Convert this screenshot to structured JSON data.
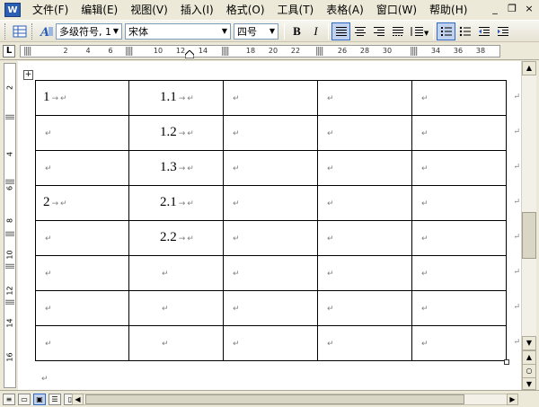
{
  "app": {
    "icon_label": "W"
  },
  "menu": {
    "items": [
      "文件(F)",
      "编辑(E)",
      "视图(V)",
      "插入(I)",
      "格式(O)",
      "工具(T)",
      "表格(A)",
      "窗口(W)",
      "帮助(H)"
    ]
  },
  "window_controls": {
    "minimize": "_",
    "restore": "❐",
    "close": "×"
  },
  "toolbar": {
    "style_value": "多级符号, 1",
    "font_value": "宋体",
    "size_value": "四号",
    "bold": "B",
    "italic": "I"
  },
  "ruler": {
    "tab_selector": "L",
    "numbers": [
      "2",
      "4",
      "6",
      "10",
      "12",
      "14",
      "18",
      "20",
      "22",
      "26",
      "28",
      "30",
      "34",
      "36",
      "38"
    ],
    "vertical_numbers": [
      "2",
      "4",
      "6",
      "8",
      "10",
      "12",
      "14",
      "16"
    ]
  },
  "table": {
    "rows": [
      [
        "1",
        "1.1",
        "",
        "",
        ""
      ],
      [
        "",
        "1.2",
        "",
        "",
        ""
      ],
      [
        "",
        "1.3",
        "",
        "",
        ""
      ],
      [
        "2",
        "2.1",
        "",
        "",
        ""
      ],
      [
        "",
        "2.2",
        "",
        "",
        ""
      ],
      [
        "",
        "",
        "",
        "",
        ""
      ],
      [
        "",
        "",
        "",
        "",
        ""
      ],
      [
        "",
        "",
        "",
        "",
        ""
      ]
    ],
    "cell_mark": "↵",
    "arrow_mark": "→"
  },
  "document": {
    "para_mark": "↵"
  },
  "scrollbar": {
    "up": "▲",
    "down": "▼",
    "prev": "▲",
    "next": "▼",
    "browse": "○",
    "left": "◀",
    "right": "▶"
  }
}
